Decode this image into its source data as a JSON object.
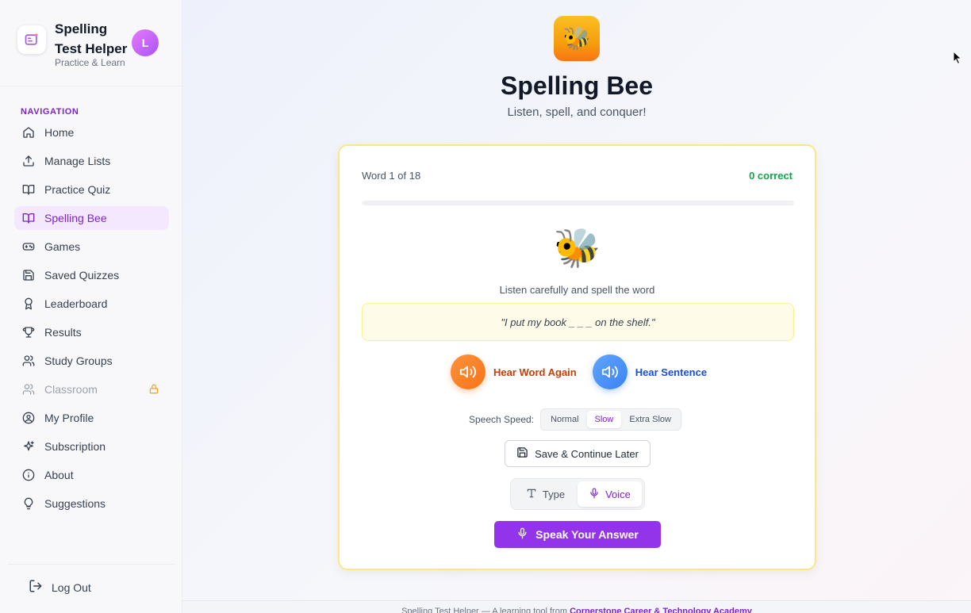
{
  "brand": {
    "title": "Spelling Test Helper",
    "subtitle": "Practice & Learn",
    "avatar_initial": "L"
  },
  "nav": {
    "heading": "NAVIGATION",
    "items": [
      {
        "label": "Home",
        "icon": "home-icon"
      },
      {
        "label": "Manage Lists",
        "icon": "upload-icon"
      },
      {
        "label": "Practice Quiz",
        "icon": "book-open-icon"
      },
      {
        "label": "Spelling Bee",
        "icon": "book-open-icon",
        "active": true
      },
      {
        "label": "Games",
        "icon": "gamepad-icon"
      },
      {
        "label": "Saved Quizzes",
        "icon": "save-icon"
      },
      {
        "label": "Leaderboard",
        "icon": "award-icon"
      },
      {
        "label": "Results",
        "icon": "trophy-icon"
      },
      {
        "label": "Study Groups",
        "icon": "users-icon"
      },
      {
        "label": "Classroom",
        "icon": "users-icon",
        "locked": true
      },
      {
        "label": "My Profile",
        "icon": "user-circle-icon"
      },
      {
        "label": "Subscription",
        "icon": "sparkles-icon"
      },
      {
        "label": "About",
        "icon": "info-icon"
      },
      {
        "label": "Suggestions",
        "icon": "lightbulb-icon"
      }
    ],
    "logout_label": "Log Out"
  },
  "page": {
    "title": "Spelling Bee",
    "subtitle": "Listen, spell, and conquer!"
  },
  "quiz": {
    "word_counter": "Word 1 of 18",
    "correct_counter": "0 correct",
    "progress_fraction": 0,
    "mascot": "🐝",
    "instruction": "Listen carefully and spell the word",
    "sentence": "\"I put my book _ _ _ on the shelf.\"",
    "hear_word_label": "Hear Word Again",
    "hear_sentence_label": "Hear Sentence",
    "speed_label": "Speech Speed:",
    "speed_options": [
      "Normal",
      "Slow",
      "Extra Slow"
    ],
    "speed_selected": "Slow",
    "save_label": "Save & Continue Later",
    "mode_type_label": "Type",
    "mode_voice_label": "Voice",
    "mode_selected": "Voice",
    "speak_label": "Speak Your Answer"
  },
  "footer": {
    "text": "Spelling Test Helper — A learning tool from ",
    "link": "Cornerstone Career & Technology Academy"
  },
  "colors": {
    "accent": "#9333ea",
    "correct": "#16a34a",
    "orange": "#f97316",
    "blue": "#3b82f6",
    "card_border": "#fde68a"
  }
}
